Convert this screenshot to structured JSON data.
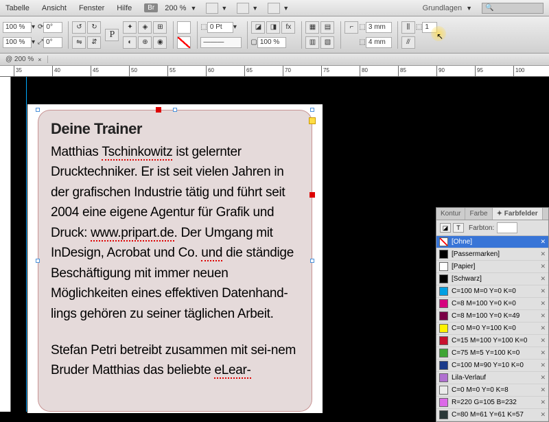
{
  "menu": {
    "tabelle": "Tabelle",
    "ansicht": "Ansicht",
    "fenster": "Fenster",
    "hilfe": "Hilfe",
    "br": "Br",
    "zoom": "200 %",
    "grundlagen": "Grundlagen"
  },
  "toolbar": {
    "pct1": "100 %",
    "pct2": "100 %",
    "deg1": "0°",
    "deg2": "0°",
    "pt": "0 Pt",
    "stroke_pct": "100 %",
    "mm3": "3 mm",
    "mm4": "4 mm",
    "one": "1"
  },
  "doctab": {
    "label": "@ 200 %"
  },
  "ruler": [
    "35",
    "40",
    "45",
    "50",
    "55",
    "60",
    "65",
    "70",
    "75",
    "80",
    "85",
    "90",
    "95",
    "100"
  ],
  "text": {
    "heading": "Deine Trainer",
    "para1_parts": [
      "Matthias ",
      "Tschinkowitz",
      " ist gelernter Drucktechniker. Er ist seit vielen Jahren in der grafischen Industrie tätig und führt seit 2004 eine eigene Agentur für Grafik und Druck: ",
      "www.pripart.de",
      ". Der Umgang mit InDesign, Acrobat und Co. ",
      "und",
      " die ständige Beschäftigung mit immer neuen Möglichkeiten eines effektiven Datenhand-lings gehören zu seiner täglichen Arbeit."
    ],
    "para2_parts": [
      "Stefan Petri betreibt zusammen mit sei-nem Bruder Matthias das beliebte ",
      "eLear-"
    ]
  },
  "panel": {
    "tabs": {
      "kontur": "Kontur",
      "farbe": "Farbe",
      "farbfelder": "Farbfelder"
    },
    "farbton": "Farbton:",
    "swatches": [
      {
        "name": "[Ohne]",
        "color": "none",
        "selected": true
      },
      {
        "name": "[Passermarken]",
        "color": "#000000"
      },
      {
        "name": "[Papier]",
        "color": "#ffffff"
      },
      {
        "name": "[Schwarz]",
        "color": "#000000"
      },
      {
        "name": "C=100 M=0 Y=0 K=0",
        "color": "#00a0e3"
      },
      {
        "name": "C=8 M=100 Y=0 K=0",
        "color": "#d6007e"
      },
      {
        "name": "C=8 M=100 Y=0 K=49",
        "color": "#7a0046"
      },
      {
        "name": "C=0 M=0 Y=100 K=0",
        "color": "#fff200"
      },
      {
        "name": "C=15 M=100 Y=100 K=0",
        "color": "#c8102e"
      },
      {
        "name": "C=75 M=5 Y=100 K=0",
        "color": "#3fa535"
      },
      {
        "name": "C=100 M=90 Y=10 K=0",
        "color": "#1b3a8a"
      },
      {
        "name": "Lila-Verlauf",
        "color": "#b070d0"
      },
      {
        "name": "C=0 M=0 Y=0 K=8",
        "color": "#ebebeb"
      },
      {
        "name": "R=220 G=105 B=232",
        "color": "#dc69e8"
      },
      {
        "name": "C=80 M=61 Y=61 K=57",
        "color": "#2b3838"
      }
    ]
  }
}
